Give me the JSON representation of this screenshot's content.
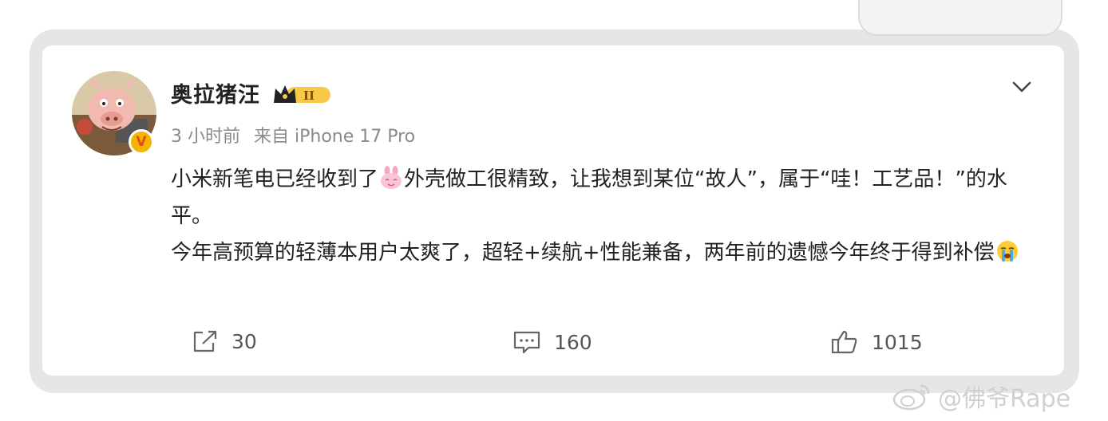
{
  "post": {
    "username": "奥拉猪汪",
    "rank_badge": "II",
    "verified_mark": "V",
    "time": "3 小时前",
    "source": "来自 iPhone 17 Pro",
    "paragraph1_a": "小米新笔电已经收到了",
    "paragraph1_b": "外壳做工很精致，让我想到某位“故人”，属于“哇！工艺品！”的水平。",
    "paragraph2_a": "今年高预算的轻薄本用户太爽了，超轻+续航+性能兼备，两年前的遗憾今年终于得到补偿",
    "emoji1": "pink-bunny-grin-emoji",
    "emoji2": "crying-face-emoji"
  },
  "actions": {
    "repost_count": "30",
    "comment_count": "160",
    "like_count": "1015"
  },
  "watermark": {
    "text": "@佛爷Rape"
  },
  "colors": {
    "frame": "#e6e6e9",
    "card": "#ffffff",
    "text": "#222222",
    "meta": "#8a8a8a",
    "badge_gold": "#f4b400"
  }
}
